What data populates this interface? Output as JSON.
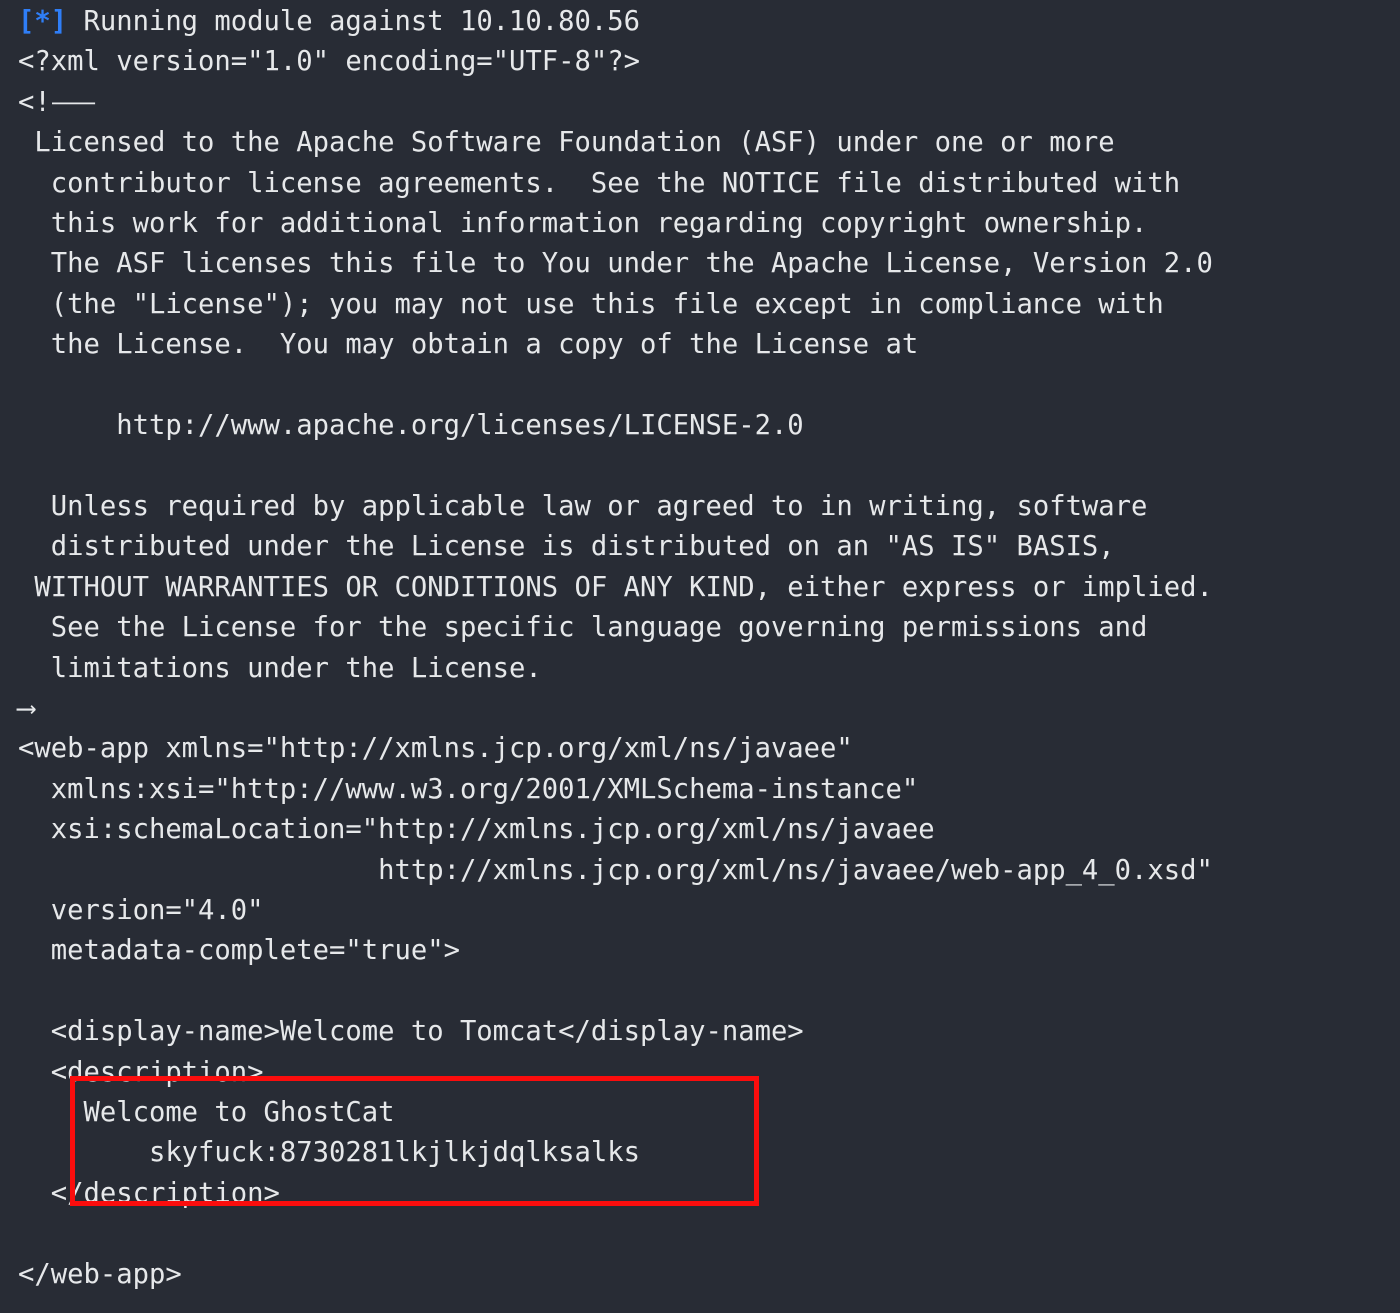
{
  "terminal": {
    "background_color": "#282c35",
    "foreground_color": "#e6e8ea",
    "accent_color": "#2f7ef7",
    "highlight_color": "#fb0d0d"
  },
  "status_line": {
    "marker": "[*]",
    "message": " Running module against 10.10.80.56",
    "target_ip": "10.10.80.56"
  },
  "output": {
    "xml_declaration": "<?xml version=\"1.0\" encoding=\"UTF-8\"?>",
    "comment_open": "<!--",
    "comment_open_glyph": "<!⸺",
    "comment_close": "-->",
    "comment_close_glyph": "⟶",
    "license_lines": [
      " Licensed to the Apache Software Foundation (ASF) under one or more",
      "  contributor license agreements.  See the NOTICE file distributed with",
      "  this work for additional information regarding copyright ownership.",
      "  The ASF licenses this file to You under the Apache License, Version 2.0",
      "  (the \"License\"); you may not use this file except in compliance with",
      "  the License.  You may obtain a copy of the License at",
      "",
      "      http://www.apache.org/licenses/LICENSE-2.0",
      "",
      "  Unless required by applicable law or agreed to in writing, software",
      "  distributed under the License is distributed on an \"AS IS\" BASIS,",
      " WITHOUT WARRANTIES OR CONDITIONS OF ANY KIND, either express or implied.",
      "  See the License for the specific language governing permissions and",
      "  limitations under the License."
    ],
    "webapp_open_lines": [
      "<web-app xmlns=\"http://xmlns.jcp.org/xml/ns/javaee\"",
      "  xmlns:xsi=\"http://www.w3.org/2001/XMLSchema-instance\"",
      "  xsi:schemaLocation=\"http://xmlns.jcp.org/xml/ns/javaee",
      "                      http://xmlns.jcp.org/xml/ns/javaee/web-app_4_0.xsd\"",
      "  version=\"4.0\"",
      "  metadata-complete=\"true\">"
    ],
    "display_name_line": "  <display-name>Welcome to Tomcat</display-name>",
    "description_open": "  <description>",
    "description_body": [
      "    Welcome to GhostCat",
      "        skyfuck:8730281lkjlkjdqlksalks"
    ],
    "description_close": "  </description>",
    "webapp_close": "</web-app>"
  },
  "leaked_credential": {
    "label": "skyfuck",
    "value": "8730281lkjlkjdqlksalks",
    "full": "skyfuck:8730281lkjlkjdqlksalks"
  }
}
